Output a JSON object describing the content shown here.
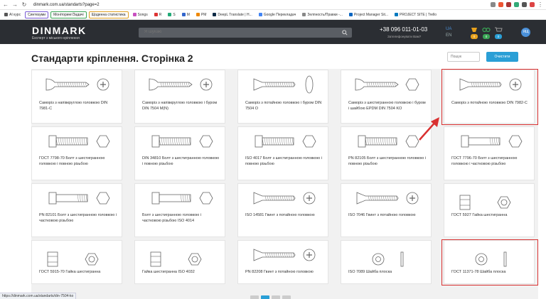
{
  "browser": {
    "url": "dinmark.com.ua/standarts?page=2",
    "bookmarks": [
      {
        "label": "AI курс",
        "color": "#555"
      },
      {
        "label": "Синтезуми",
        "color": "#7a5cd6",
        "tag": true
      },
      {
        "label": "Моніторинг/Задачі",
        "color": "#3aa655",
        "tag": true
      },
      {
        "label": "Щоденна статистика",
        "color": "#e0a020",
        "tag": true
      },
      {
        "label": "Songs",
        "color": "#c850c0"
      },
      {
        "label": "R",
        "color": "#d33"
      },
      {
        "label": "S",
        "color": "#2a7"
      },
      {
        "label": "M",
        "color": "#36c"
      },
      {
        "label": "PM",
        "color": "#e80"
      },
      {
        "label": "DeepL Translate | H...",
        "color": "#0f2b46"
      },
      {
        "label": "Google Перекладач",
        "color": "#4285f4"
      },
      {
        "label": "Зелпность/Правки -...",
        "color": "#888"
      },
      {
        "label": "Project Manager Sit...",
        "color": "#0a66c2"
      },
      {
        "label": "PROJECT SITE | Trello",
        "color": "#0079bf"
      }
    ],
    "status_url": "https://dinmark.com.ua/standarts/din-7504-ko"
  },
  "header": {
    "logo": "DINMARK",
    "logo_sub": "Експерт з міського кріплення",
    "search_placeholder": "Я шукаю",
    "phone": "+38 096 011-01-03",
    "phone_sub": "Зателефонувати Вам?",
    "lang_ua": "UA",
    "lang_en": "EN",
    "badge_compare": "0",
    "badge_favorites": "0",
    "badge_cart": "0",
    "avatar": "ЯЩ"
  },
  "page": {
    "title": "Стандарти кріплення. Сторінка 2",
    "filter_placeholder": "Пошук",
    "clear_label": "Очистити"
  },
  "cards": [
    {
      "label": "Саморіз з напівкруглою головкою DIN 7981-C",
      "icon": "pan-head-screw",
      "highlight": false
    },
    {
      "label": "Саморіз з напівкруглою головкою і буром DIN 7504 M(N)",
      "icon": "pan-head-drill-screw",
      "highlight": false
    },
    {
      "label": "Саморіз з потайною головкою і буром DIN 7504 O",
      "icon": "countersunk-drill-screw",
      "highlight": false
    },
    {
      "label": "Саморіз з шестигранною головкою і буром і шайбою EPDM DIN 7504 KO",
      "icon": "hex-washer-drill-screw",
      "highlight": false
    },
    {
      "label": "Саморіз з потайною головкою DIN 7982-C",
      "icon": "countersunk-screw",
      "highlight": true
    },
    {
      "label": "ГОСТ 7798-70 Болт з шестигранною головкою і повною різьбою",
      "icon": "hex-bolt",
      "highlight": false
    },
    {
      "label": "DIN 34810 Болт з шестигранною головкою і повною різьбою",
      "icon": "hex-bolt",
      "highlight": false
    },
    {
      "label": "ISO 4017 Болт з шестигранною головкою і повною різьбою",
      "icon": "hex-bolt",
      "highlight": false
    },
    {
      "label": "PN 82105 Болт з шестигранною головкою і повною різьбою",
      "icon": "hex-bolt",
      "highlight": false
    },
    {
      "label": "ГОСТ 7796-70 Болт з шестигранною головкою і частковою різьбою",
      "icon": "hex-bolt-partial",
      "highlight": false
    },
    {
      "label": "PN 82101 Болт з шестигранною головкою і частковою різьбою",
      "icon": "hex-bolt-partial",
      "highlight": false
    },
    {
      "label": "Болт з шестигранною головкою і частковою різьбою ISO 4014",
      "icon": "hex-bolt-partial",
      "highlight": false
    },
    {
      "label": "ISO 14581 Гвинт з потайною головкою",
      "icon": "countersunk-screw",
      "highlight": false
    },
    {
      "label": "ISO 7046 Гвинт з потайною головкою",
      "icon": "countersunk-screw",
      "highlight": false
    },
    {
      "label": "ГОСТ 5927 Гайка шестигранна",
      "icon": "hex-nut",
      "highlight": false
    },
    {
      "label": "ГОСТ 5915-70 Гайка шестигранна",
      "icon": "hex-nut",
      "highlight": false
    },
    {
      "label": "Гайка шестигранна ISO 4032",
      "icon": "hex-nut",
      "highlight": false
    },
    {
      "label": "PN 82208 Гвинт з потайною головкою",
      "icon": "countersunk-screw",
      "highlight": false
    },
    {
      "label": "ISO 7089 Шайба плоска",
      "icon": "flat-washer",
      "highlight": false
    },
    {
      "label": "ГОСТ 11371-78 Шайба плоска",
      "icon": "flat-washer",
      "highlight": true
    }
  ],
  "colors": {
    "header_bg": "#2b2e33",
    "accent": "#2a9fd6",
    "highlight": "#d93030"
  }
}
